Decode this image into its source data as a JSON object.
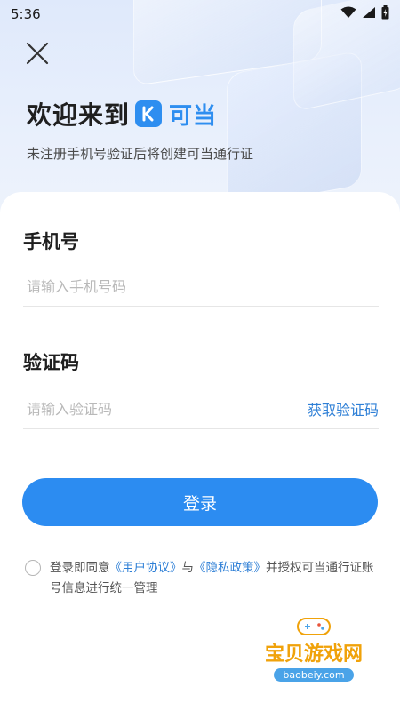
{
  "status_bar": {
    "time": "5:36"
  },
  "header": {
    "welcome": "欢迎来到",
    "brand_name": "可当",
    "subtitle": "未注册手机号验证后将创建可当通行证"
  },
  "form": {
    "phone_label": "手机号",
    "phone_placeholder": "请输入手机号码",
    "phone_value": "",
    "code_label": "验证码",
    "code_placeholder": "请输入验证码",
    "code_value": "",
    "get_code_label": "获取验证码",
    "login_label": "登录"
  },
  "agreement": {
    "checked": false,
    "prefix": "登录即同意",
    "user_agreement": "《用户协议》",
    "and": "与",
    "privacy_policy": "《隐私政策》",
    "suffix": "并授权可当通行证账号信息进行统一管理"
  },
  "watermark": {
    "title": "宝贝游戏网",
    "url": "baobeiy.com"
  },
  "colors": {
    "accent": "#2c8cf1",
    "link": "#2e7fd6"
  }
}
